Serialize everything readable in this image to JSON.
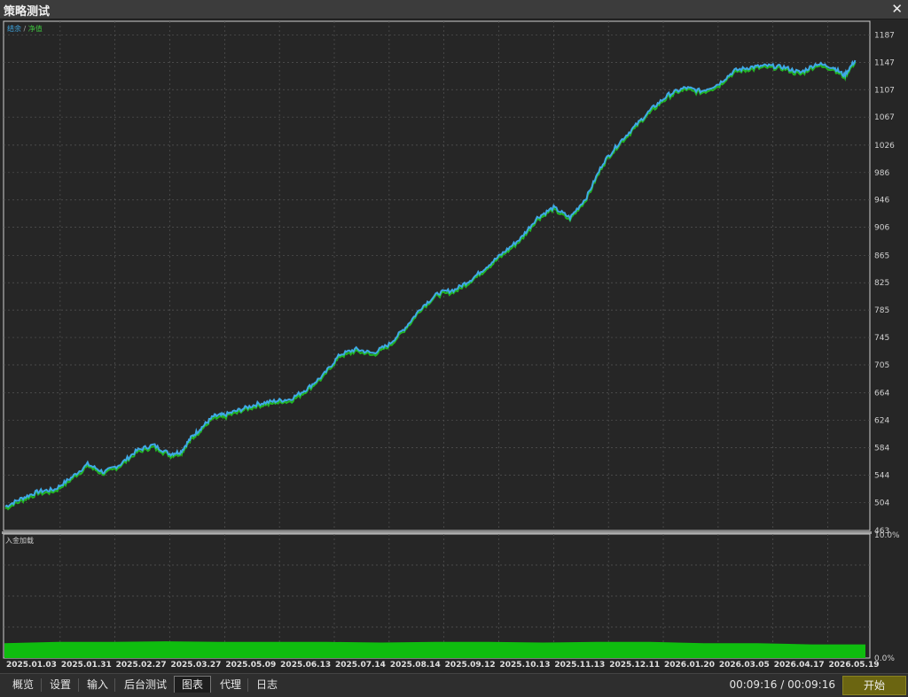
{
  "window": {
    "title": "策略测试",
    "close_glyph": "✕"
  },
  "legend": {
    "balance": "结余",
    "separator": "/",
    "equity": "净值"
  },
  "sub_chart": {
    "label": "入金加载"
  },
  "tabs": [
    {
      "label": "概览",
      "active": false
    },
    {
      "label": "设置",
      "active": false
    },
    {
      "label": "输入",
      "active": false
    },
    {
      "label": "后台测试",
      "active": false
    },
    {
      "label": "图表",
      "active": true
    },
    {
      "label": "代理",
      "active": false
    },
    {
      "label": "日志",
      "active": false
    }
  ],
  "timer": {
    "elapsed": "00:09:16",
    "separator": "/",
    "total": "00:09:16"
  },
  "start_button": {
    "label": "开始"
  },
  "colors": {
    "balance": "#3fa9e6",
    "equity": "#22b522",
    "deposit_load": "#0fbd0f",
    "grid": "#555555",
    "background": "#262626"
  },
  "chart_data": [
    {
      "type": "line",
      "series": [
        {
          "name": "结余",
          "color": "#3fa9e6"
        },
        {
          "name": "净值",
          "color": "#22b522"
        }
      ],
      "x_tick_labels": [
        "2025.01.03",
        "2025.01.31",
        "2025.02.27",
        "2025.03.27",
        "2025.05.09",
        "2025.06.13",
        "2025.07.14",
        "2025.08.14",
        "2025.09.12",
        "2025.10.13",
        "2025.11.13",
        "2025.12.11",
        "2026.01.20",
        "2026.03.05",
        "2026.04.17",
        "2026.05.19"
      ],
      "y_tick_labels": [
        "463",
        "504",
        "544",
        "584",
        "624",
        "664",
        "705",
        "745",
        "785",
        "825",
        "865",
        "906",
        "946",
        "986",
        "1026",
        "1067",
        "1107",
        "1147",
        "1187"
      ],
      "ylim": [
        463,
        1207
      ],
      "grid": true,
      "points_x_index": [
        0,
        0.3,
        0.6,
        0.9,
        1.2,
        1.5,
        1.8,
        2.1,
        2.4,
        2.7,
        3.0,
        3.2,
        3.4,
        3.6,
        3.8,
        4.0,
        4.3,
        4.6,
        4.9,
        5.2,
        5.5,
        5.8,
        6.1,
        6.4,
        6.7,
        7.0,
        7.3,
        7.6,
        7.9,
        8.2,
        8.5,
        8.8,
        9.1,
        9.4,
        9.7,
        10.0,
        10.3,
        10.6,
        10.9,
        11.2,
        11.5,
        11.8,
        12.1,
        12.4,
        12.7,
        13.0,
        13.3,
        13.6,
        13.9,
        14.2,
        14.5,
        14.8,
        15.1,
        15.3,
        15.5
      ],
      "balance": [
        498,
        510,
        520,
        523,
        540,
        560,
        548,
        560,
        580,
        588,
        575,
        578,
        600,
        615,
        630,
        632,
        640,
        648,
        652,
        655,
        670,
        690,
        720,
        728,
        722,
        735,
        760,
        790,
        810,
        815,
        830,
        850,
        870,
        890,
        920,
        935,
        920,
        950,
        1000,
        1030,
        1055,
        1080,
        1100,
        1110,
        1105,
        1115,
        1135,
        1140,
        1142,
        1140,
        1132,
        1145,
        1140,
        1128,
        1150
      ]
    },
    {
      "type": "area",
      "name": "入金加载",
      "y_tick_labels": [
        "10.0%",
        "0.0%"
      ],
      "ylim": [
        0,
        10
      ],
      "level_pct": 1.3,
      "values": [
        1.2,
        1.3,
        1.3,
        1.35,
        1.3,
        1.3,
        1.3,
        1.25,
        1.3,
        1.3,
        1.25,
        1.3,
        1.3,
        1.2,
        1.2,
        1.1,
        1.1
      ]
    }
  ]
}
